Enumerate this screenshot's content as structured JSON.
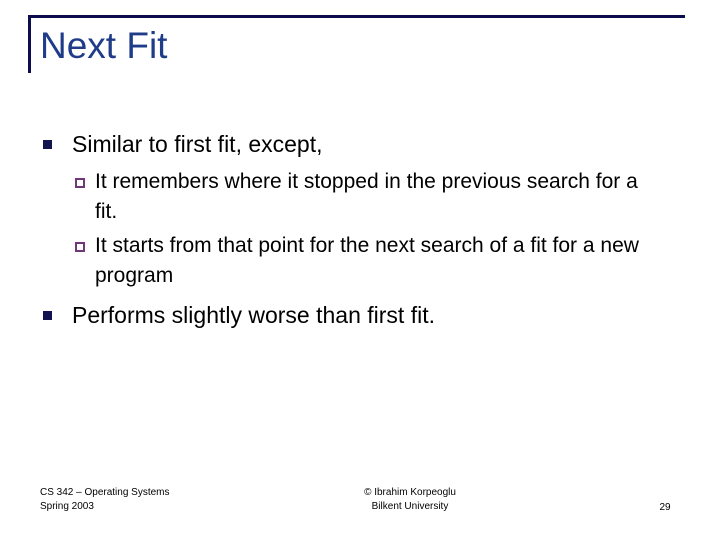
{
  "slide": {
    "title": "Next Fit",
    "page_number": "29",
    "accent_color": "#1f3c88",
    "rule_color": "#0d0d4d",
    "bullet_l1_color": "#13134f",
    "bullet_l2_color": "#70387a",
    "text_color": "#000000",
    "background_color": "#ffffff"
  },
  "content": {
    "bullets": [
      {
        "level": 1,
        "marker": "filled-square",
        "text": "Similar to first fit, except,"
      },
      {
        "level": 2,
        "marker": "hollow-square",
        "text": "It remembers where it stopped in the previous search for a fit."
      },
      {
        "level": 2,
        "marker": "hollow-square",
        "text": "It starts from that point for the next search of a fit for a new program"
      },
      {
        "level": 1,
        "marker": "filled-square",
        "text": "Performs slightly worse than first fit."
      }
    ]
  },
  "footer": {
    "course_line1": "CS 342 – Operating Systems",
    "course_line2": "Spring 2003",
    "credit_line1": "© Ibrahim Korpeoglu",
    "credit_line2": "Bilkent University"
  }
}
